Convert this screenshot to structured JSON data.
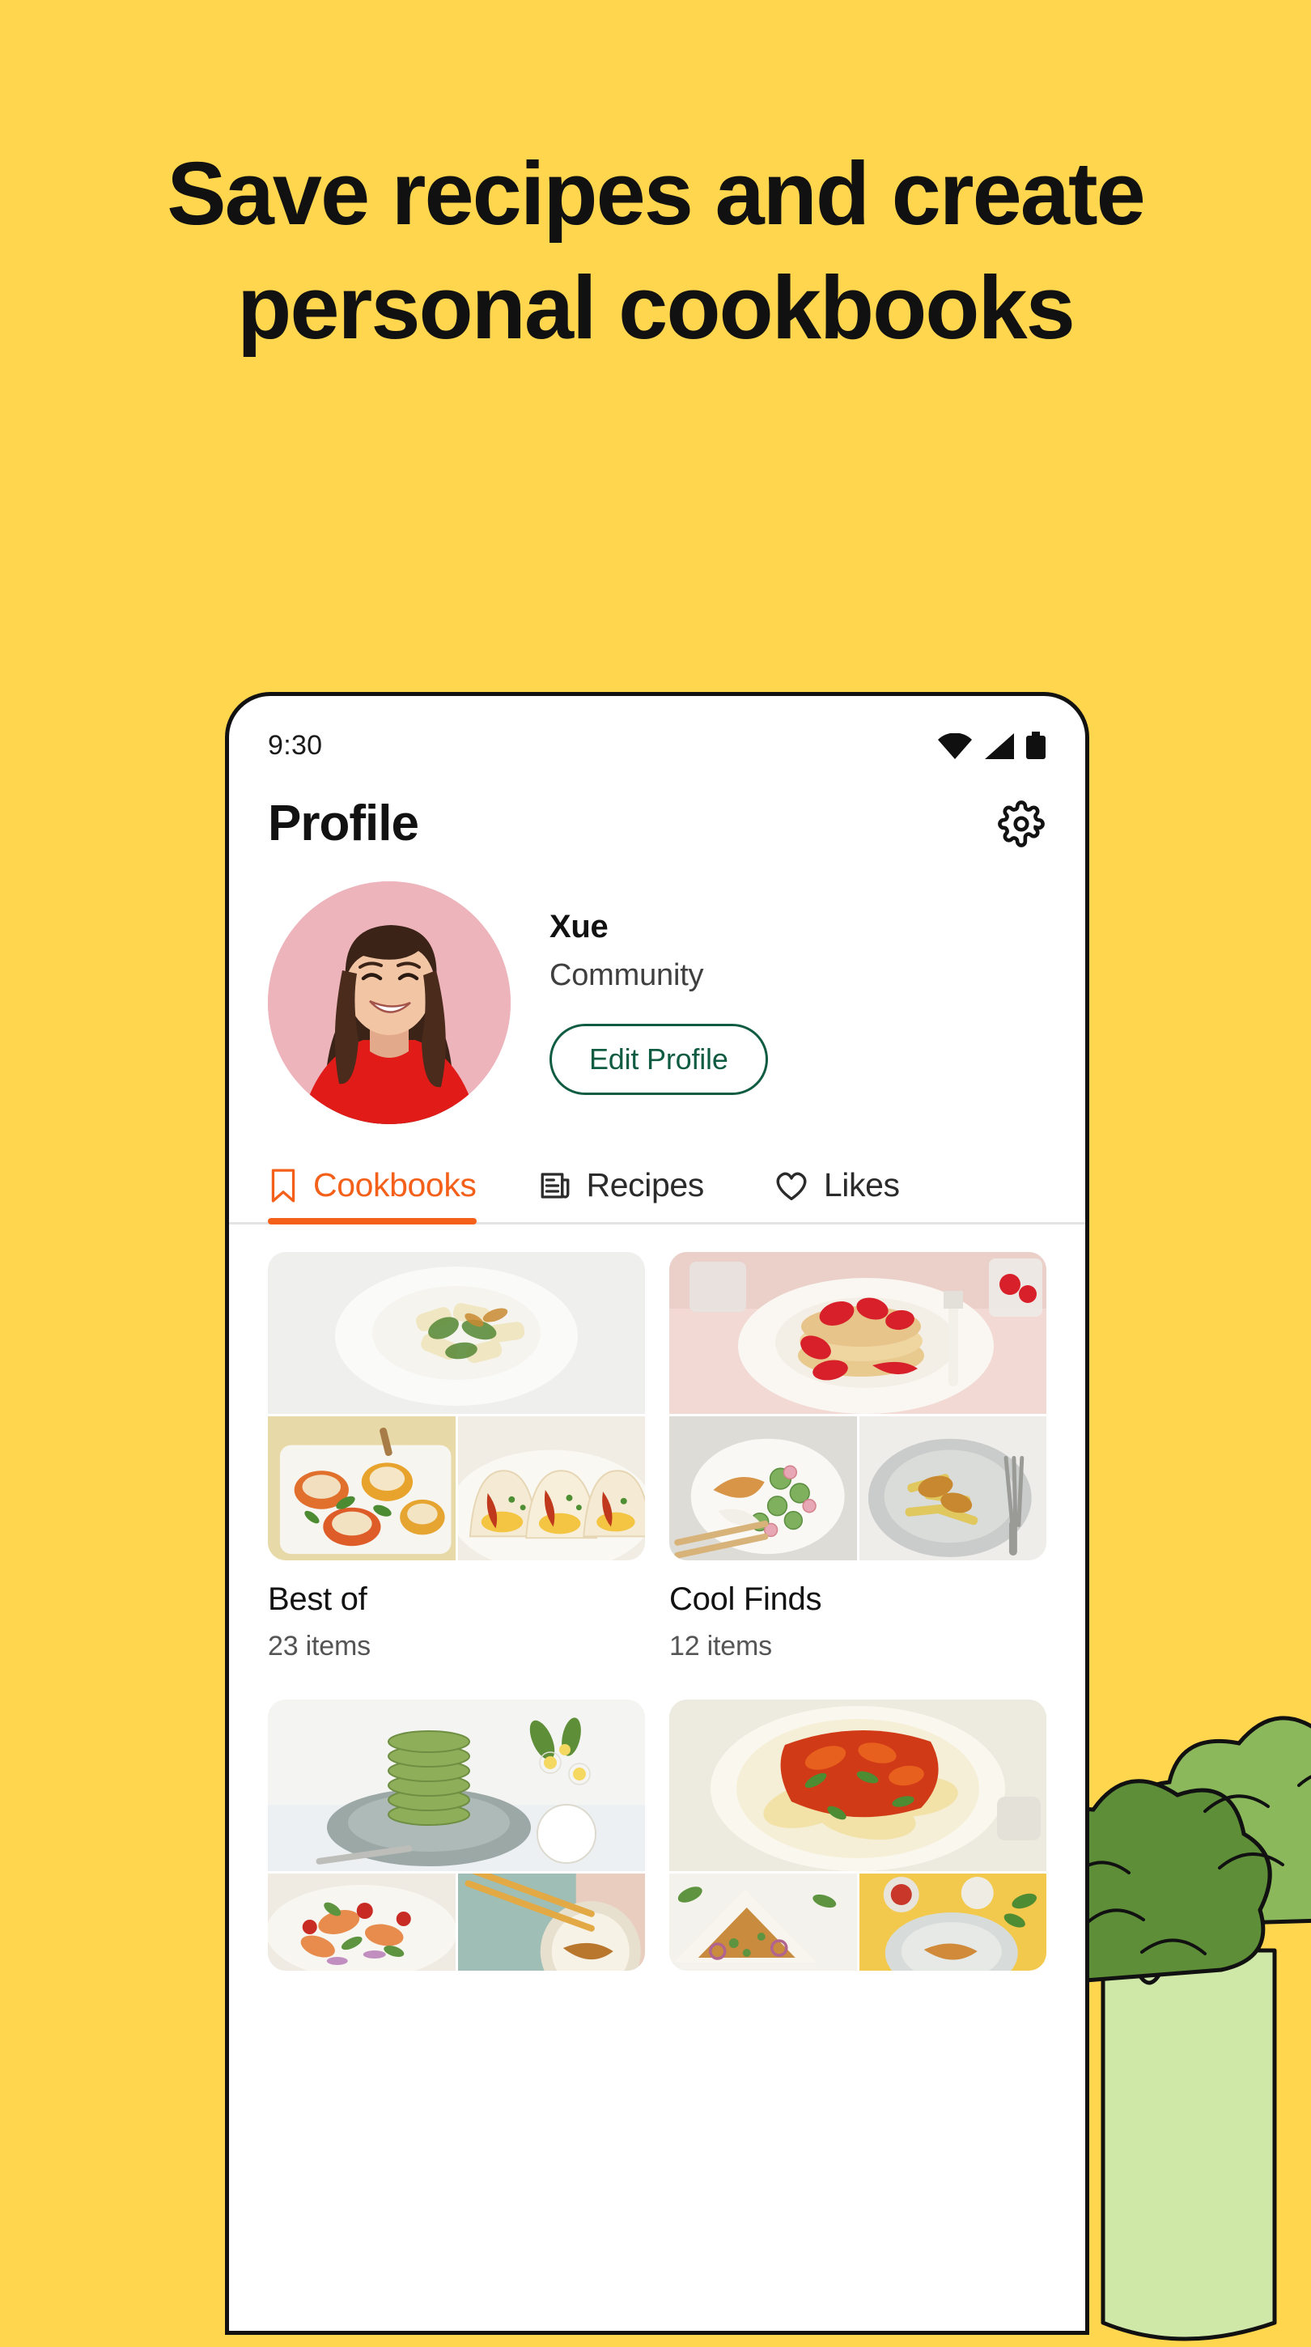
{
  "promo": {
    "headline": "Save recipes and create personal cookbooks",
    "background_color": "#FFD64D",
    "decoration_icon": "broccoli-illustration"
  },
  "phone": {
    "status_bar": {
      "time": "9:30",
      "icons": [
        "wifi-icon",
        "cellular-signal-icon",
        "battery-icon"
      ]
    },
    "header": {
      "title": "Profile",
      "settings_icon": "gear-icon"
    },
    "profile": {
      "avatar_alt": "user-avatar",
      "name": "Xue",
      "role": "Community",
      "edit_button": "Edit Profile",
      "accent_color": "#0F5C42"
    },
    "tabs": {
      "active_color": "#F4601A",
      "items": [
        {
          "label": "Cookbooks",
          "icon": "bookmark-icon",
          "active": true
        },
        {
          "label": "Recipes",
          "icon": "article-icon",
          "active": false
        },
        {
          "label": "Likes",
          "icon": "heart-icon",
          "active": false
        }
      ]
    },
    "cookbooks": [
      {
        "title": "Best of",
        "count": "23 items"
      },
      {
        "title": "Cool Finds",
        "count": "12 items"
      },
      {
        "title": "",
        "count": ""
      },
      {
        "title": "",
        "count": ""
      }
    ]
  }
}
